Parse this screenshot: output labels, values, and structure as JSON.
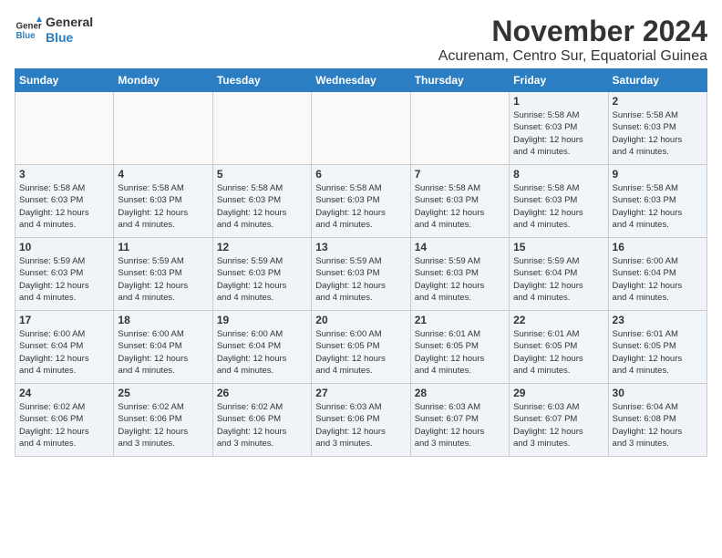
{
  "logo": {
    "line1": "General",
    "line2": "Blue"
  },
  "title": "November 2024",
  "location": "Acurenam, Centro Sur, Equatorial Guinea",
  "days_of_week": [
    "Sunday",
    "Monday",
    "Tuesday",
    "Wednesday",
    "Thursday",
    "Friday",
    "Saturday"
  ],
  "weeks": [
    [
      {
        "day": "",
        "detail": ""
      },
      {
        "day": "",
        "detail": ""
      },
      {
        "day": "",
        "detail": ""
      },
      {
        "day": "",
        "detail": ""
      },
      {
        "day": "",
        "detail": ""
      },
      {
        "day": "1",
        "detail": "Sunrise: 5:58 AM\nSunset: 6:03 PM\nDaylight: 12 hours\nand 4 minutes."
      },
      {
        "day": "2",
        "detail": "Sunrise: 5:58 AM\nSunset: 6:03 PM\nDaylight: 12 hours\nand 4 minutes."
      }
    ],
    [
      {
        "day": "3",
        "detail": "Sunrise: 5:58 AM\nSunset: 6:03 PM\nDaylight: 12 hours\nand 4 minutes."
      },
      {
        "day": "4",
        "detail": "Sunrise: 5:58 AM\nSunset: 6:03 PM\nDaylight: 12 hours\nand 4 minutes."
      },
      {
        "day": "5",
        "detail": "Sunrise: 5:58 AM\nSunset: 6:03 PM\nDaylight: 12 hours\nand 4 minutes."
      },
      {
        "day": "6",
        "detail": "Sunrise: 5:58 AM\nSunset: 6:03 PM\nDaylight: 12 hours\nand 4 minutes."
      },
      {
        "day": "7",
        "detail": "Sunrise: 5:58 AM\nSunset: 6:03 PM\nDaylight: 12 hours\nand 4 minutes."
      },
      {
        "day": "8",
        "detail": "Sunrise: 5:58 AM\nSunset: 6:03 PM\nDaylight: 12 hours\nand 4 minutes."
      },
      {
        "day": "9",
        "detail": "Sunrise: 5:58 AM\nSunset: 6:03 PM\nDaylight: 12 hours\nand 4 minutes."
      }
    ],
    [
      {
        "day": "10",
        "detail": "Sunrise: 5:59 AM\nSunset: 6:03 PM\nDaylight: 12 hours\nand 4 minutes."
      },
      {
        "day": "11",
        "detail": "Sunrise: 5:59 AM\nSunset: 6:03 PM\nDaylight: 12 hours\nand 4 minutes."
      },
      {
        "day": "12",
        "detail": "Sunrise: 5:59 AM\nSunset: 6:03 PM\nDaylight: 12 hours\nand 4 minutes."
      },
      {
        "day": "13",
        "detail": "Sunrise: 5:59 AM\nSunset: 6:03 PM\nDaylight: 12 hours\nand 4 minutes."
      },
      {
        "day": "14",
        "detail": "Sunrise: 5:59 AM\nSunset: 6:03 PM\nDaylight: 12 hours\nand 4 minutes."
      },
      {
        "day": "15",
        "detail": "Sunrise: 5:59 AM\nSunset: 6:04 PM\nDaylight: 12 hours\nand 4 minutes."
      },
      {
        "day": "16",
        "detail": "Sunrise: 6:00 AM\nSunset: 6:04 PM\nDaylight: 12 hours\nand 4 minutes."
      }
    ],
    [
      {
        "day": "17",
        "detail": "Sunrise: 6:00 AM\nSunset: 6:04 PM\nDaylight: 12 hours\nand 4 minutes."
      },
      {
        "day": "18",
        "detail": "Sunrise: 6:00 AM\nSunset: 6:04 PM\nDaylight: 12 hours\nand 4 minutes."
      },
      {
        "day": "19",
        "detail": "Sunrise: 6:00 AM\nSunset: 6:04 PM\nDaylight: 12 hours\nand 4 minutes."
      },
      {
        "day": "20",
        "detail": "Sunrise: 6:00 AM\nSunset: 6:05 PM\nDaylight: 12 hours\nand 4 minutes."
      },
      {
        "day": "21",
        "detail": "Sunrise: 6:01 AM\nSunset: 6:05 PM\nDaylight: 12 hours\nand 4 minutes."
      },
      {
        "day": "22",
        "detail": "Sunrise: 6:01 AM\nSunset: 6:05 PM\nDaylight: 12 hours\nand 4 minutes."
      },
      {
        "day": "23",
        "detail": "Sunrise: 6:01 AM\nSunset: 6:05 PM\nDaylight: 12 hours\nand 4 minutes."
      }
    ],
    [
      {
        "day": "24",
        "detail": "Sunrise: 6:02 AM\nSunset: 6:06 PM\nDaylight: 12 hours\nand 4 minutes."
      },
      {
        "day": "25",
        "detail": "Sunrise: 6:02 AM\nSunset: 6:06 PM\nDaylight: 12 hours\nand 3 minutes."
      },
      {
        "day": "26",
        "detail": "Sunrise: 6:02 AM\nSunset: 6:06 PM\nDaylight: 12 hours\nand 3 minutes."
      },
      {
        "day": "27",
        "detail": "Sunrise: 6:03 AM\nSunset: 6:06 PM\nDaylight: 12 hours\nand 3 minutes."
      },
      {
        "day": "28",
        "detail": "Sunrise: 6:03 AM\nSunset: 6:07 PM\nDaylight: 12 hours\nand 3 minutes."
      },
      {
        "day": "29",
        "detail": "Sunrise: 6:03 AM\nSunset: 6:07 PM\nDaylight: 12 hours\nand 3 minutes."
      },
      {
        "day": "30",
        "detail": "Sunrise: 6:04 AM\nSunset: 6:08 PM\nDaylight: 12 hours\nand 3 minutes."
      }
    ]
  ]
}
